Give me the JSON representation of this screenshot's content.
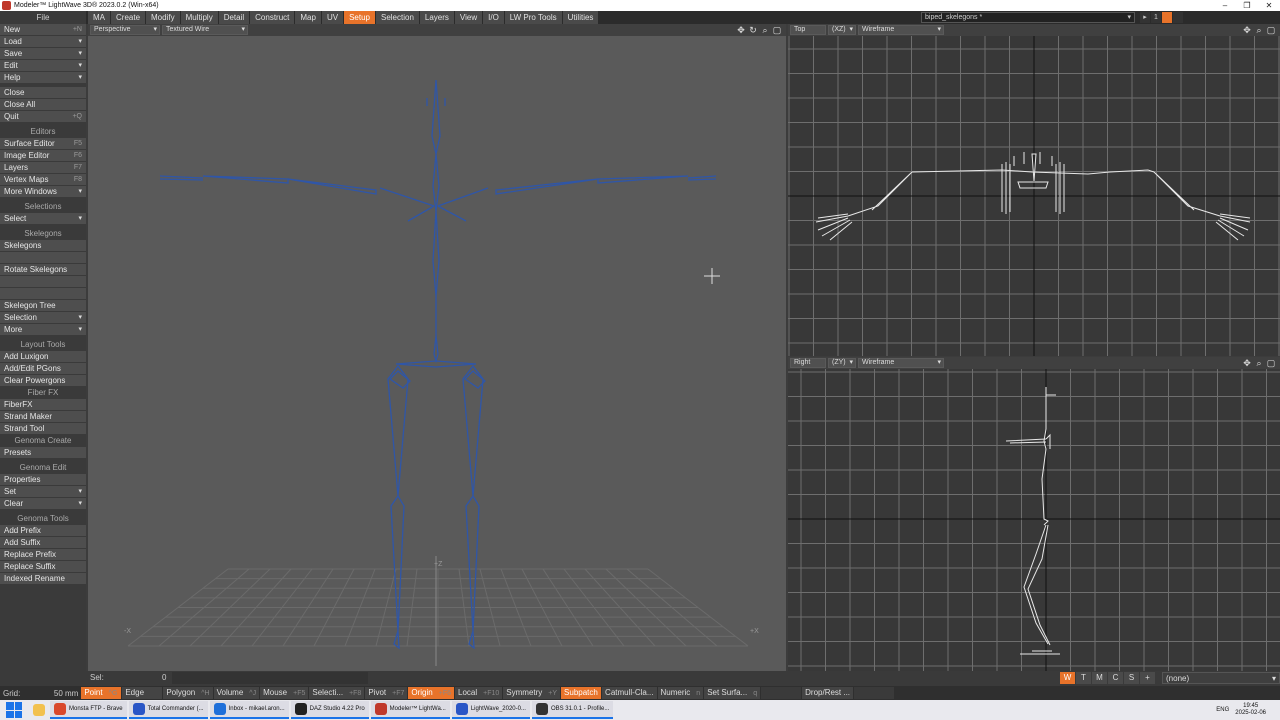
{
  "window": {
    "title": "Modeler™ LightWave 3D® 2023.0.2 (Win-x64)",
    "controls": [
      "–",
      "❐",
      "✕"
    ]
  },
  "menu": {
    "file_header": "File",
    "tabs": [
      "MA",
      "Create",
      "Modify",
      "Multiply",
      "Detail",
      "Construct",
      "Map",
      "UV",
      "Setup",
      "Selection",
      "Layers",
      "View",
      "I/O",
      "LW Pro Tools",
      "Utilities"
    ],
    "active_tab": "Setup",
    "object_name": "biped_skelegons *",
    "layer_number": "1"
  },
  "left_panel": {
    "file_items": [
      {
        "label": "New",
        "shortcut": "+N"
      },
      {
        "label": "Load",
        "dropdown": true
      },
      {
        "label": "Save",
        "dropdown": true
      },
      {
        "label": "Edit",
        "dropdown": true
      },
      {
        "label": "Help",
        "dropdown": true
      }
    ],
    "close_items": [
      {
        "label": "Close"
      },
      {
        "label": "Close All"
      },
      {
        "label": "Quit",
        "shortcut": "+Q"
      }
    ],
    "editors_header": "Editors",
    "editors": [
      {
        "label": "Surface Editor",
        "shortcut": "F5"
      },
      {
        "label": "Image Editor",
        "shortcut": "F6"
      },
      {
        "label": "Layers",
        "shortcut": "F7"
      },
      {
        "label": "Vertex Maps",
        "shortcut": "F8"
      },
      {
        "label": "More Windows",
        "dropdown": true
      }
    ],
    "selections_header": "Selections",
    "selections": [
      {
        "label": "Select",
        "dropdown": true
      }
    ],
    "skelegons_header": "Skelegons",
    "skelegons": [
      {
        "label": "Skelegons"
      },
      {
        "label": "",
        "dim": true
      },
      {
        "label": "Rotate Skelegons"
      },
      {
        "label": "",
        "dim": true
      },
      {
        "label": "",
        "dim": true
      },
      {
        "label": "Skelegon Tree"
      },
      {
        "label": "Selection",
        "dropdown": true
      },
      {
        "label": "More",
        "dropdown": true
      }
    ],
    "layout_tools_header": "Layout Tools",
    "layout_tools": [
      {
        "label": "Add Luxigon"
      },
      {
        "label": "Add/Edit PGons"
      },
      {
        "label": "Clear Powergons"
      }
    ],
    "fiberfx_header": "Fiber FX",
    "fiberfx": [
      {
        "label": "FiberFX"
      },
      {
        "label": "Strand Maker"
      },
      {
        "label": "Strand Tool"
      }
    ],
    "genoma_create_header": "Genoma Create",
    "genoma_create": [
      {
        "label": "Presets"
      }
    ],
    "genoma_edit_header": "Genoma Edit",
    "genoma_edit": [
      {
        "label": "Properties"
      },
      {
        "label": "Set",
        "dropdown": true
      },
      {
        "label": "Clear",
        "dropdown": true
      }
    ],
    "genoma_tools_header": "Genoma Tools",
    "genoma_tools": [
      {
        "label": "Add Prefix"
      },
      {
        "label": "Add Suffix"
      },
      {
        "label": "Replace Prefix"
      },
      {
        "label": "Replace Suffix"
      },
      {
        "label": "Indexed Rename"
      }
    ]
  },
  "viewports": {
    "perspective": {
      "view": "Perspective",
      "mode": "Textured Wire",
      "axis_z": "+Z",
      "axis_x_neg": "-X",
      "axis_x_pos": "+X"
    },
    "top": {
      "view": "Top",
      "axes": "(XZ)",
      "mode": "Wireframe"
    },
    "right": {
      "view": "Right",
      "axes": "(ZY)",
      "mode": "Wireframe"
    },
    "tool_icons": [
      "✥",
      "↻",
      "🔍",
      "▢"
    ]
  },
  "status": {
    "sel_label": "Sel:",
    "sel_value": "0",
    "view_buttons": [
      "W",
      "T",
      "M",
      "C",
      "S",
      "+"
    ],
    "view_buttons_active": "W",
    "surface_value": "(none)"
  },
  "bottom_bar": {
    "grid_label": "Grid:",
    "grid_value": "50 mm",
    "items": [
      {
        "label": "Point",
        "shortcut": "^G",
        "on": true
      },
      {
        "label": "Edge",
        "shortcut": ""
      },
      {
        "label": "Polygon",
        "shortcut": "^H"
      },
      {
        "label": "Volume",
        "shortcut": "^J"
      },
      {
        "label": "Mouse",
        "shortcut": "+F5"
      },
      {
        "label": "Selecti...",
        "shortcut": "+F8"
      },
      {
        "label": "Pivot",
        "shortcut": "+F7"
      },
      {
        "label": "Origin",
        "shortcut": "+F6",
        "on": true
      },
      {
        "label": "Local",
        "shortcut": "+F10"
      },
      {
        "label": "Symmetry",
        "shortcut": "+Y"
      },
      {
        "label": "Subpatch",
        "shortcut": "",
        "on": true
      },
      {
        "label": "Catmull-Cla...",
        "shortcut": ""
      },
      {
        "label": "Numeric",
        "shortcut": "n"
      },
      {
        "label": "Set Surfa...",
        "shortcut": "q"
      },
      {
        "label": "",
        "dim": true
      },
      {
        "label": "Drop/Rest ...",
        "shortcut": ""
      },
      {
        "label": "",
        "dim": true
      }
    ]
  },
  "taskbar": {
    "tasks": [
      {
        "label": "Monsta FTP - Brave",
        "color": "#d9482b"
      },
      {
        "label": "Total Commander (...",
        "color": "#2a56c6"
      },
      {
        "label": "Inbox - mikael.aron...",
        "color": "#1e6fd9"
      },
      {
        "label": "DAZ Studio 4.22 Pro",
        "color": "#222222"
      },
      {
        "label": "Modeler™ LightWa...",
        "color": "#c0392b"
      },
      {
        "label": "LightWave_2020-0...",
        "color": "#2a56c6"
      },
      {
        "label": "OBS 31.0.1 - Profile...",
        "color": "#333333"
      }
    ],
    "tray_language": "ENG",
    "time": "19:45",
    "date": "2025-02-06"
  }
}
